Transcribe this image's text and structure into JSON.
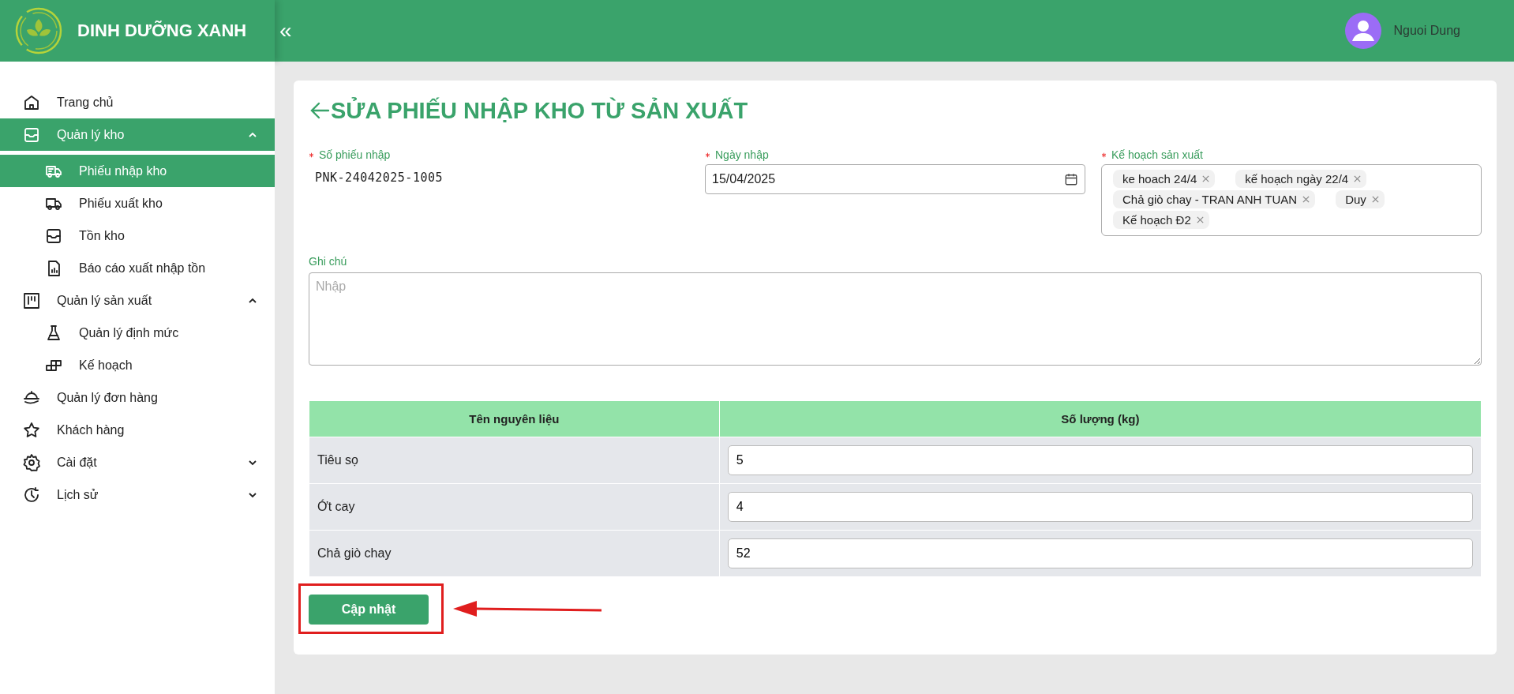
{
  "header": {
    "brand": "DINH DƯỠNG XANH",
    "collapse": "«",
    "user": "Nguoi Dung"
  },
  "sidebar": {
    "items": [
      {
        "label": "Trang chủ",
        "selected": false
      },
      {
        "label": "Quản lý kho",
        "selected": true,
        "expanded": true,
        "children": [
          {
            "label": "Phiếu nhập kho",
            "selected": true
          },
          {
            "label": "Phiếu xuất kho",
            "selected": false
          },
          {
            "label": "Tồn kho",
            "selected": false
          },
          {
            "label": "Báo cáo xuất nhập tồn",
            "selected": false
          }
        ]
      },
      {
        "label": "Quản lý sản xuất",
        "selected": false,
        "expanded": true,
        "children": [
          {
            "label": "Quản lý định mức",
            "selected": false
          },
          {
            "label": "Kế hoạch",
            "selected": false
          }
        ]
      },
      {
        "label": "Quản lý đơn hàng",
        "selected": false
      },
      {
        "label": "Khách hàng",
        "selected": false
      },
      {
        "label": "Cài đặt",
        "selected": false,
        "expanded": false
      },
      {
        "label": "Lịch sử",
        "selected": false,
        "expanded": false
      }
    ]
  },
  "page": {
    "title": "SỬA PHIẾU NHẬP KHO TỪ SẢN XUẤT",
    "fields": [
      {
        "kind": "text",
        "label": "Số phiếu nhập",
        "required": true,
        "value": "PNK-24042025-1005"
      },
      {
        "kind": "date",
        "label": "Ngày nhập",
        "required": true,
        "value": "15/04/2025"
      },
      {
        "kind": "tags",
        "label": "Kế hoạch sản xuất",
        "required": true,
        "tags": [
          "ke hoach 24/4",
          "kế hoạch ngày 22/4",
          "Chả giò chay - TRAN ANH TUAN",
          "Duy",
          "Kế hoạch Đ2"
        ]
      }
    ],
    "note": {
      "label": "Ghi chú",
      "required": false,
      "placeholder": "Nhập"
    },
    "table": {
      "columns": [
        "Tên nguyên liệu",
        "Số lượng (kg)"
      ],
      "rows": [
        {
          "name": "Tiêu sọ",
          "quantity": "5"
        },
        {
          "name": "Ớt cay",
          "quantity": "4"
        },
        {
          "name": "Chả giò chay",
          "quantity": "52"
        }
      ]
    },
    "submit": "Cập nhật"
  }
}
